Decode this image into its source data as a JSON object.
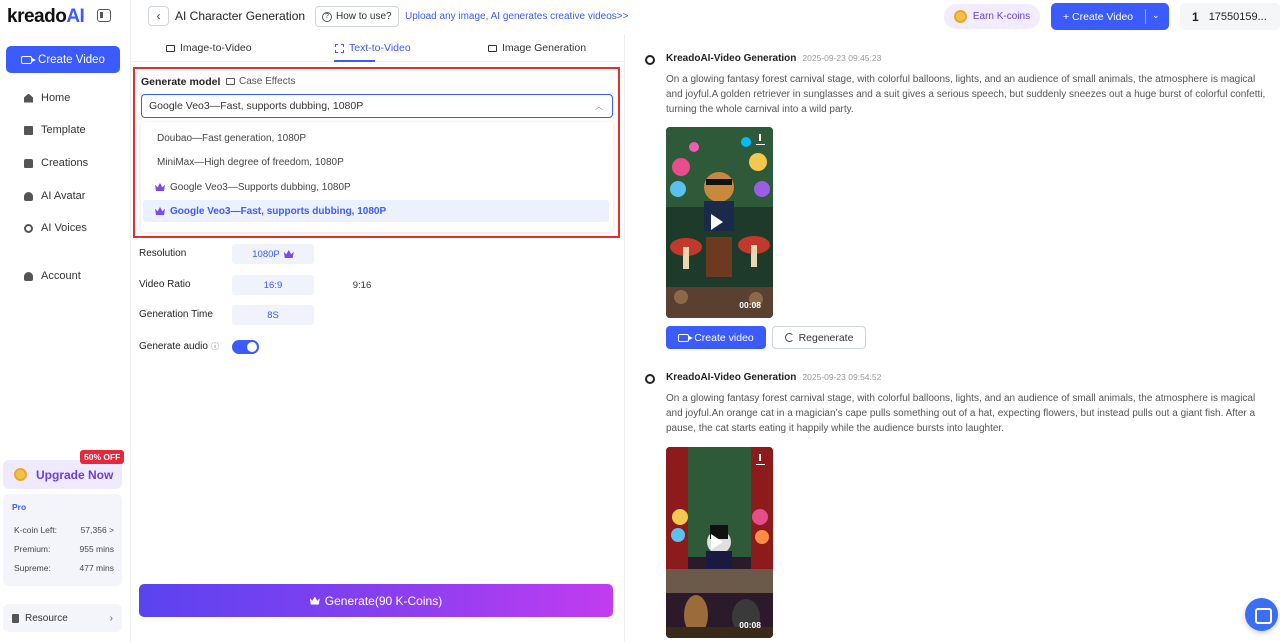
{
  "app": {
    "logo_main": "kreado",
    "logo_ai": "AI",
    "page_title": "AI Character Generation",
    "how_to": "How to use?",
    "tagline": "Upload any image, AI generates creative videos>>"
  },
  "header": {
    "earn_label": "Earn K-coins",
    "create_label": "+ Create Video",
    "user_num": "1",
    "user_id": "17550159..."
  },
  "sidebar": {
    "create_label": "Create Video",
    "items": [
      {
        "label": "Home",
        "icon": "home-icon"
      },
      {
        "label": "Template",
        "icon": "template-icon"
      },
      {
        "label": "Creations",
        "icon": "creations-icon"
      },
      {
        "label": "AI Avatar",
        "icon": "avatar-icon"
      },
      {
        "label": "AI Voices",
        "icon": "voices-icon"
      },
      {
        "label": "Account",
        "icon": "account-icon"
      }
    ],
    "upgrade_label": "Upgrade Now",
    "off_badge": "50% OFF",
    "plan": "Pro",
    "kcoin_label": "K-coin Left:",
    "kcoin_value": "57,356 >",
    "premium_label": "Premium:",
    "premium_value": "955 mins",
    "supreme_label": "Supreme:",
    "supreme_value": "477 mins",
    "resource_label": "Resource",
    "resource_chevron": "›"
  },
  "tabs": [
    {
      "label": "Image-to-Video",
      "active": false
    },
    {
      "label": "Text-to-Video",
      "active": true
    },
    {
      "label": "Image Generation",
      "active": false
    }
  ],
  "model": {
    "label": "Generate model",
    "case_effects": "Case Effects",
    "selected": "Google Veo3—Fast, supports dubbing, 1080P",
    "options": [
      {
        "label": "Doubao—Fast generation, 1080P",
        "premium": false
      },
      {
        "label": "MiniMax—High degree of freedom, 1080P",
        "premium": false
      },
      {
        "label": "Google Veo3—Supports dubbing, 1080P",
        "premium": true
      },
      {
        "label": "Google Veo3—Fast, supports dubbing, 1080P",
        "premium": true
      }
    ]
  },
  "settings": {
    "resolution_label": "Resolution",
    "resolution_value": "1080P",
    "ratio_label": "Video Ratio",
    "ratio_options": [
      "16:9",
      "9:16"
    ],
    "time_label": "Generation Time",
    "time_value": "8S",
    "audio_label": "Generate audio",
    "audio_on": true
  },
  "generate_label": "Generate(90 K-Coins)",
  "feed": [
    {
      "title": "KreadoAI-Video Generation",
      "time": "2025-09-23 09:45:23",
      "text": "On a glowing fantasy forest carnival stage, with colorful balloons, lights, and an audience of small animals, the atmosphere is magical and joyful.A golden retriever in sunglasses and a suit gives a serious speech, but suddenly sneezes out a huge burst of colorful confetti, turning the whole carnival into a wild party.",
      "duration": "00:08",
      "create_label": "Create video",
      "regen_label": "Regenerate"
    },
    {
      "title": "KreadoAI-Video Generation",
      "time": "2025-09-23 09:54:52",
      "text": "On a glowing fantasy forest carnival stage, with colorful balloons, lights, and an audience of small animals, the atmosphere is magical and joyful.An orange cat in a magician’s cape pulls something out of a hat, expecting flowers, but instead pulls out a giant fish. After a pause, the cat starts eating it happily while the audience bursts into laughter.",
      "duration": "00:08"
    }
  ],
  "colors": {
    "accent": "#3b5bfd",
    "highlight_border": "#e0302f",
    "upgrade_purple": "#6b3fd9"
  }
}
